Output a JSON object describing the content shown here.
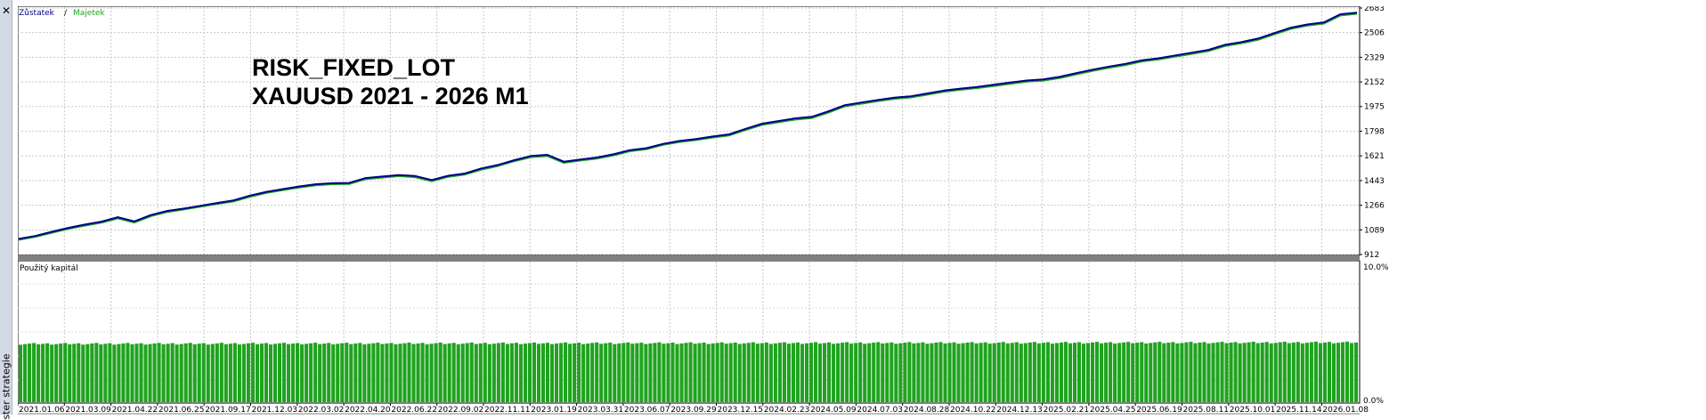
{
  "panel": {
    "close_icon": "close-icon",
    "side_label": "ster strategie"
  },
  "legend": {
    "balance": "Zůstatek",
    "separator": " / ",
    "equity": "Majetek",
    "balance_color": "#00008b",
    "equity_color": "#1fa31f"
  },
  "overlay": {
    "line1": "RISK_FIXED_LOT",
    "line2": "XAUUSD 2021 - 2026 M1"
  },
  "chart_data": [
    {
      "type": "line",
      "series": [
        {
          "name": "Zůstatek",
          "values": [
            1024,
            1045,
            1075,
            1103,
            1127,
            1148,
            1180,
            1150,
            1195,
            1225,
            1242,
            1262,
            1282,
            1301,
            1335,
            1362,
            1382,
            1401,
            1417,
            1424,
            1426,
            1461,
            1472,
            1483,
            1476,
            1447,
            1478,
            1494,
            1530,
            1555,
            1590,
            1620,
            1628,
            1579,
            1595,
            1609,
            1632,
            1662,
            1676,
            1707,
            1728,
            1742,
            1760,
            1775,
            1815,
            1852,
            1871,
            1890,
            1901,
            1940,
            1985,
            2004,
            2022,
            2039,
            2049,
            2069,
            2090,
            2104,
            2116,
            2131,
            2147,
            2162,
            2170,
            2188,
            2215,
            2240,
            2262,
            2282,
            2308,
            2322,
            2342,
            2362,
            2382,
            2418,
            2438,
            2463,
            2503,
            2542,
            2565,
            2580,
            2638,
            2650
          ]
        },
        {
          "name": "Majetek",
          "values": [
            1018,
            1039,
            1068,
            1097,
            1120,
            1141,
            1172,
            1142,
            1188,
            1218,
            1236,
            1256,
            1275,
            1294,
            1327,
            1355,
            1375,
            1394,
            1410,
            1418,
            1419,
            1454,
            1465,
            1476,
            1468,
            1439,
            1471,
            1487,
            1522,
            1548,
            1583,
            1612,
            1620,
            1571,
            1588,
            1602,
            1625,
            1655,
            1669,
            1700,
            1721,
            1735,
            1753,
            1768,
            1808,
            1844,
            1863,
            1882,
            1893,
            1932,
            1977,
            1996,
            2014,
            2031,
            2041,
            2061,
            2082,
            2096,
            2108,
            2123,
            2139,
            2154,
            2162,
            2180,
            2207,
            2232,
            2254,
            2274,
            2300,
            2314,
            2334,
            2354,
            2374,
            2410,
            2430,
            2455,
            2495,
            2534,
            2557,
            2572,
            2630,
            2642
          ]
        }
      ],
      "ylim": [
        912,
        2683
      ],
      "yticks": [
        "2683",
        "2506",
        "2329",
        "2152",
        "1975",
        "1798",
        "1621",
        "1443",
        "1266",
        "1089",
        "912"
      ],
      "grid": true
    },
    {
      "type": "bar",
      "title": "Použitý kapitál",
      "ylim": [
        0,
        10
      ],
      "yticks": [
        "10.0%",
        "0.0%"
      ],
      "level_start": 4.15,
      "level_end": 4.25,
      "categories": [
        "2021.01.06",
        "2021.03.09",
        "2021.04.22",
        "2021.06.25",
        "2021.09.17",
        "2021.12.03",
        "2022.03.02",
        "2022.04.20",
        "2022.06.22",
        "2022.09.02",
        "2022.11.11",
        "2023.01.19",
        "2023.03.31",
        "2023.06.07",
        "2023.09.29",
        "2023.12.15",
        "2024.02.23",
        "2024.05.09",
        "2024.07.03",
        "2024.08.28",
        "2024.10.22",
        "2024.12.13",
        "2025.02.21",
        "2025.04.25",
        "2025.06.19",
        "2025.08.11",
        "2025.10.01",
        "2025.11.14",
        "2026.01.08"
      ]
    }
  ]
}
